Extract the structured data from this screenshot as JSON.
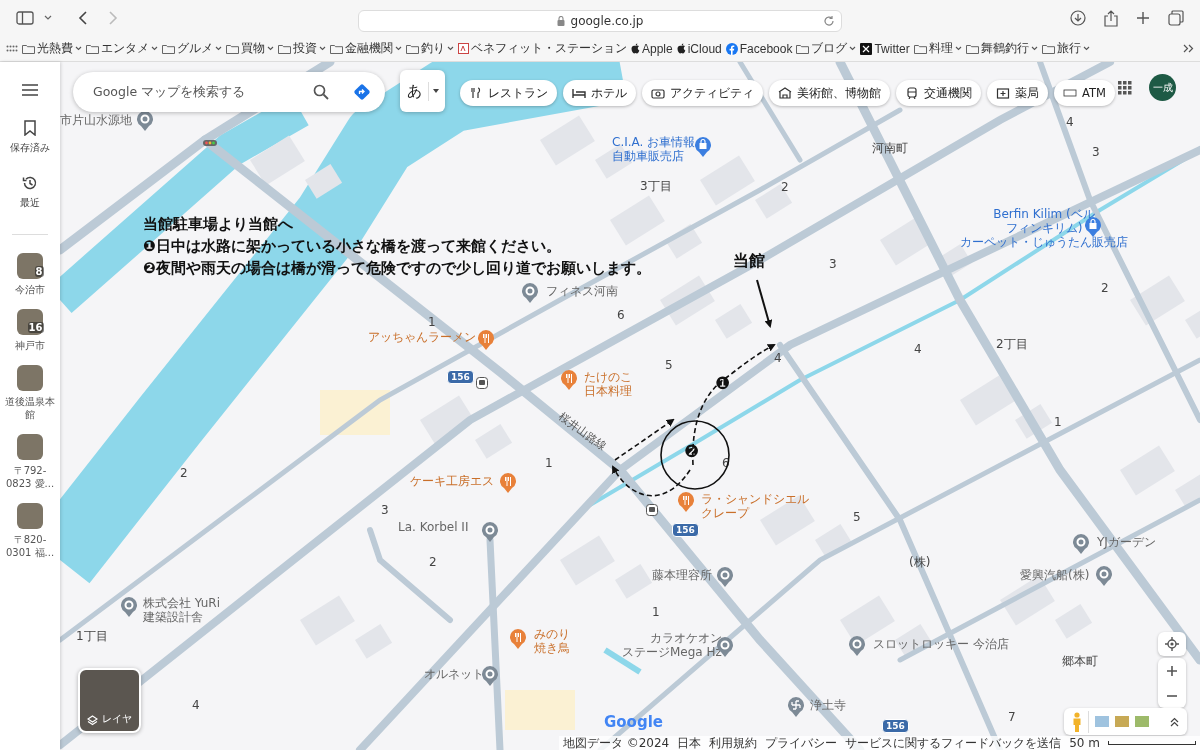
{
  "browser": {
    "url": "google.co.jp",
    "bookmarks": [
      {
        "label": "光熱費",
        "kind": "folder"
      },
      {
        "label": "エンタメ",
        "kind": "folder"
      },
      {
        "label": "グルメ",
        "kind": "folder"
      },
      {
        "label": "買物",
        "kind": "folder"
      },
      {
        "label": "投資",
        "kind": "folder"
      },
      {
        "label": "金融機関",
        "kind": "folder"
      },
      {
        "label": "釣り",
        "kind": "folder"
      },
      {
        "label": "ベネフィット・ステーション",
        "kind": "site"
      },
      {
        "label": "Apple",
        "kind": "apple"
      },
      {
        "label": "iCloud",
        "kind": "apple"
      },
      {
        "label": "Facebook",
        "kind": "facebook"
      },
      {
        "label": "ブログ",
        "kind": "folder"
      },
      {
        "label": "Twitter",
        "kind": "x"
      },
      {
        "label": "料理",
        "kind": "folder"
      },
      {
        "label": "舞鶴釣行",
        "kind": "folder"
      },
      {
        "label": "旅行",
        "kind": "folder"
      }
    ]
  },
  "sidebar": {
    "items": [
      {
        "label": "保存済み",
        "kind": "saved"
      },
      {
        "label": "最近",
        "kind": "recent"
      }
    ],
    "recents": [
      {
        "label": "今治市",
        "count": "8"
      },
      {
        "label": "神戸市",
        "count": "16"
      },
      {
        "label": "道後温泉本館"
      },
      {
        "label": "〒792-0823 愛..."
      },
      {
        "label": "〒820-0301 福..."
      }
    ]
  },
  "search": {
    "placeholder": "Google マップを検索する"
  },
  "input_mode": "あ",
  "chips": [
    {
      "label": "レストラン",
      "kind": "restaurant"
    },
    {
      "label": "ホテル",
      "kind": "hotel"
    },
    {
      "label": "アクティビティ",
      "kind": "activity"
    },
    {
      "label": "美術館、博物館",
      "kind": "museum"
    },
    {
      "label": "交通機関",
      "kind": "transit"
    },
    {
      "label": "薬局",
      "kind": "pharmacy"
    },
    {
      "label": "ATM",
      "kind": "atm"
    }
  ],
  "account": "一成",
  "annotation": {
    "title": "当館駐車場より当館へ",
    "lines": [
      "❶日中は水路に架かっている小さな橋を渡って来館ください。",
      "❷夜間や雨天の場合は橋が滑って危険ですので少し回り道でお願いします。"
    ],
    "destination": "当館",
    "steps": [
      "❶",
      "❷"
    ]
  },
  "map_labels": [
    {
      "text": "市片山水源地",
      "kind": "poi"
    },
    {
      "text": "C.I.A. お車情報",
      "subtitle": "自動車販売店",
      "kind": "shop"
    },
    {
      "text": "3丁目",
      "kind": "area"
    },
    {
      "text": "2",
      "kind": "area"
    },
    {
      "text": "河南町",
      "kind": "area"
    },
    {
      "text": "4",
      "kind": "area"
    },
    {
      "text": "3",
      "kind": "area"
    },
    {
      "lines": [
        "Berfin Kilim (ベル",
        "フィンキリム)"
      ],
      "subtitle": "カーペット・じゅうたん販売店",
      "kind": "shop"
    },
    {
      "text": "3",
      "kind": "area"
    },
    {
      "text": "2",
      "kind": "area"
    },
    {
      "text": "フィネス河南",
      "kind": "poi"
    },
    {
      "text": "6",
      "kind": "area"
    },
    {
      "text": "1",
      "kind": "area"
    },
    {
      "text": "アッちゃんラーメン",
      "kind": "food"
    },
    {
      "text": "4",
      "kind": "area"
    },
    {
      "text": "5",
      "kind": "area"
    },
    {
      "text": "2丁目",
      "kind": "area"
    },
    {
      "text": "4",
      "kind": "area"
    },
    {
      "text": "156",
      "kind": "route"
    },
    {
      "text": "たけのこ",
      "subtitle": "日本料理",
      "kind": "food"
    },
    {
      "text": "桜井山路線",
      "kind": "road"
    },
    {
      "text": "1",
      "kind": "area"
    },
    {
      "text": "1",
      "kind": "area"
    },
    {
      "text": "2",
      "kind": "area"
    },
    {
      "text": "ケーキ工房エス",
      "kind": "food"
    },
    {
      "text": "3",
      "kind": "area"
    },
    {
      "text": "ラ・シャンドシエル",
      "subtitle": "クレープ",
      "kind": "food"
    },
    {
      "text": "La. Korbel II",
      "kind": "poi"
    },
    {
      "text": "5",
      "kind": "area"
    },
    {
      "text": "156",
      "kind": "route"
    },
    {
      "text": "2",
      "kind": "area"
    },
    {
      "text": "YJガーデン",
      "kind": "poi"
    },
    {
      "text": "(株)",
      "kind": "area"
    },
    {
      "text": "藤本理容所",
      "kind": "poi"
    },
    {
      "text": "愛興汽船(株)",
      "kind": "poi"
    },
    {
      "lines": [
        "株式会社 YuRi",
        "建築設計舎"
      ],
      "kind": "poi"
    },
    {
      "text": "1",
      "kind": "area"
    },
    {
      "text": "1丁目",
      "kind": "area"
    },
    {
      "text": "みのり",
      "subtitle": "焼き鳥",
      "kind": "food"
    },
    {
      "lines": [
        "カラオケオン",
        "ステージMega Hz"
      ],
      "kind": "poi"
    },
    {
      "text": "スロットロッキー 今治店",
      "kind": "poi"
    },
    {
      "text": "郷本町",
      "kind": "area"
    },
    {
      "text": "オルネット",
      "kind": "poi"
    },
    {
      "text": "4",
      "kind": "area"
    },
    {
      "text": "浄土寺",
      "kind": "temple"
    },
    {
      "text": "7",
      "kind": "area"
    },
    {
      "text": "156",
      "kind": "route"
    },
    {
      "text": "6",
      "kind": "area"
    }
  ],
  "layers": "レイヤ",
  "logo": "Google",
  "footer": [
    "地図データ ©2024",
    "日本",
    "利用規約",
    "プライバシー",
    "サービスに関するフィードバックを送信"
  ],
  "scale": "50 m"
}
